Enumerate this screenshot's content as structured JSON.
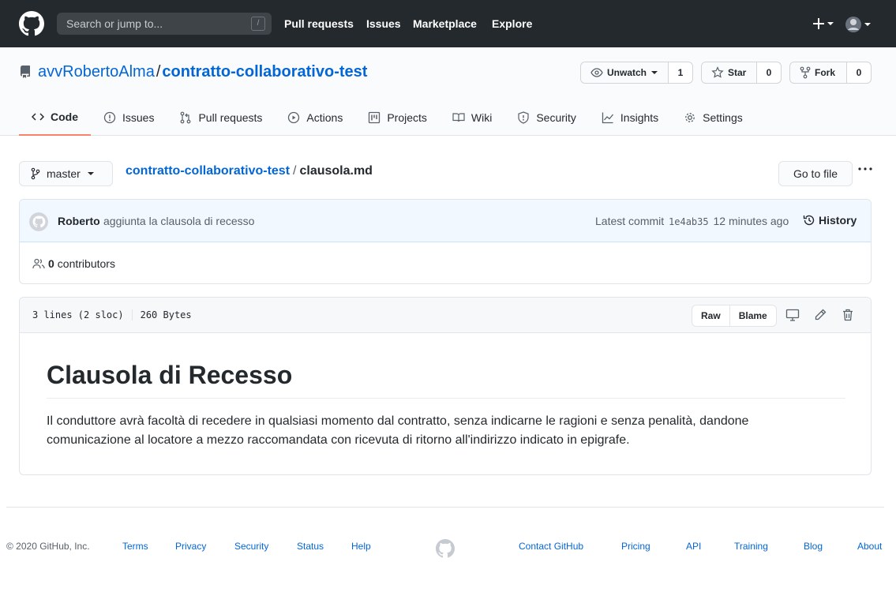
{
  "header": {
    "search_placeholder": "Search or jump to...",
    "search_shortcut": "/",
    "nav": [
      "Pull requests",
      "Issues",
      "Marketplace",
      "Explore"
    ],
    "plus_label": "+"
  },
  "repo": {
    "owner": "avvRobertoAlma",
    "separator": "/",
    "name": "contratto-collaborativo-test",
    "watch_label": "Unwatch",
    "watch_count": "1",
    "star_label": "Star",
    "star_count": "0",
    "fork_label": "Fork",
    "fork_count": "0"
  },
  "tabs": [
    {
      "label": "Code",
      "icon": "code-icon",
      "selected": true
    },
    {
      "label": "Issues",
      "icon": "issue-icon"
    },
    {
      "label": "Pull requests",
      "icon": "pull-request-icon"
    },
    {
      "label": "Actions",
      "icon": "play-icon"
    },
    {
      "label": "Projects",
      "icon": "project-icon"
    },
    {
      "label": "Wiki",
      "icon": "book-icon"
    },
    {
      "label": "Security",
      "icon": "shield-icon"
    },
    {
      "label": "Insights",
      "icon": "graph-icon"
    },
    {
      "label": "Settings",
      "icon": "gear-icon"
    }
  ],
  "file_nav": {
    "branch": "master",
    "breadcrumb_repo": "contratto-collaborativo-test",
    "breadcrumb_sep": "/",
    "breadcrumb_file": "clausola.md",
    "goto_label": "Go to file"
  },
  "commit": {
    "author": "Roberto",
    "message": "aggiunta la clausola di recesso",
    "latest_label": "Latest commit",
    "sha": "1e4ab35",
    "time": "12 minutes ago",
    "history_label": "History",
    "contributors_count": "0",
    "contributors_label": "contributors"
  },
  "file": {
    "lines": "3 lines (2 sloc)",
    "size": "260 Bytes",
    "raw_label": "Raw",
    "blame_label": "Blame",
    "title": "Clausola di Recesso",
    "paragraph_line1": "Il conduttore avrà facoltà di recedere in qualsiasi momento dal contratto, senza indicarne le ragioni e senza penalità, dandone",
    "paragraph_line2": "comunicazione al locatore a mezzo raccomandata con ricevuta di ritorno all'indirizzo indicato in epigrafe."
  },
  "footer": {
    "copyright": "© 2020 GitHub, Inc.",
    "left_links": [
      "Terms",
      "Privacy",
      "Security",
      "Status",
      "Help"
    ],
    "right_links": [
      "Contact GitHub",
      "Pricing",
      "API",
      "Training",
      "Blog",
      "About"
    ]
  },
  "colors": {
    "header_bg": "#24292e",
    "link": "#0366d6",
    "tab_underline": "#f9826c",
    "commit_bg": "#f1f8ff"
  }
}
